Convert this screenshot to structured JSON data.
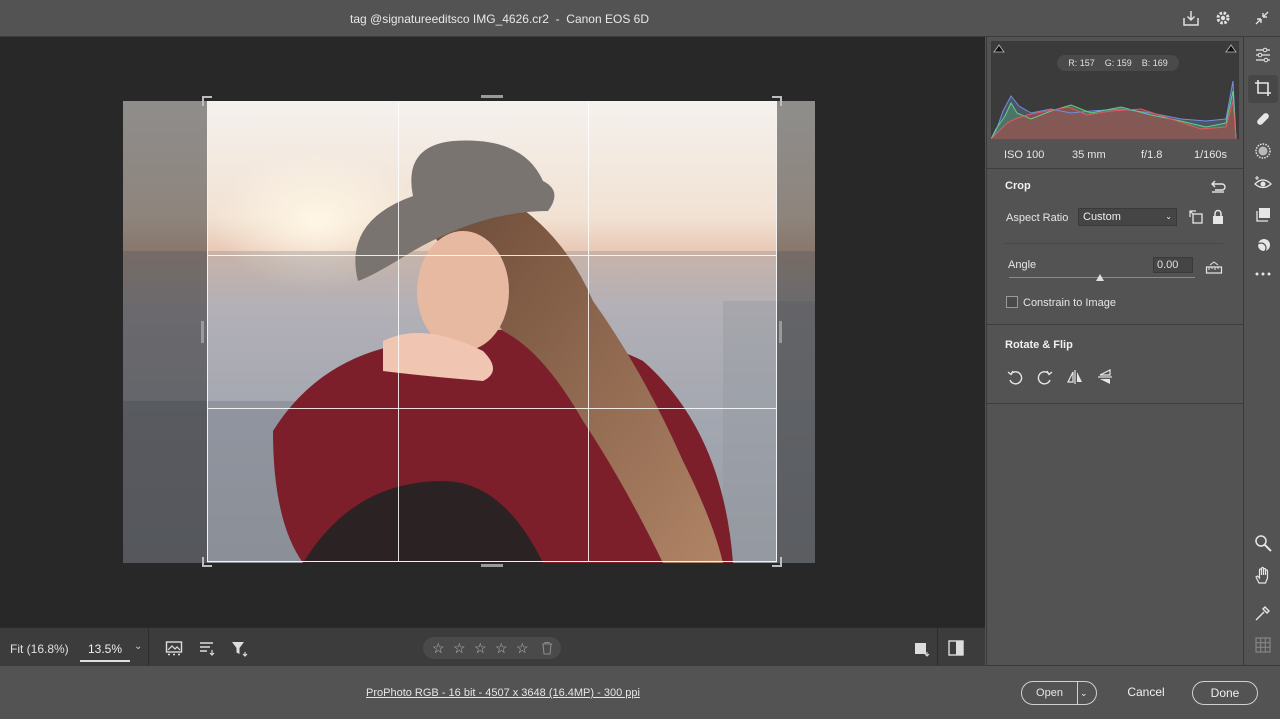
{
  "window": {
    "title": "tag @signatureeditsco IMG_4626.cr2  -  Canon EOS 6D"
  },
  "histogram": {
    "readout": "R: 157    G: 159    B: 169"
  },
  "exif": {
    "iso": "ISO 100",
    "focal": "35 mm",
    "aperture": "f/1.8",
    "shutter": "1/160s"
  },
  "crop_panel": {
    "title": "Crop",
    "aspect_label": "Aspect Ratio",
    "aspect_value": "Custom",
    "angle_label": "Angle",
    "angle_value": "0.00",
    "angle_slider_fraction": 0.5,
    "constrain_label": "Constrain to Image",
    "constrain_checked": false
  },
  "rotate_panel": {
    "title": "Rotate & Flip"
  },
  "bottom_bar": {
    "fit_label": "Fit (16.8%)",
    "zoom_value": "13.5%",
    "rating_stars": [
      "☆",
      "☆",
      "☆",
      "☆",
      "☆"
    ]
  },
  "status": {
    "info": "ProPhoto RGB - 16 bit - 4507 x 3648 (16.4MP) - 300 ppi"
  },
  "buttons": {
    "open": "Open",
    "cancel": "Cancel",
    "done": "Done"
  },
  "icons": {
    "top": [
      "save-icon",
      "settings-icon",
      "collapse-icon"
    ],
    "toolstrip": [
      "edit-sliders-icon",
      "crop-icon",
      "healing-icon",
      "mask-icon",
      "red-eye-icon",
      "snapshots-icon",
      "presets-icon",
      "more-icon",
      "zoom-icon",
      "hand-icon",
      "color-sampler-icon",
      "grid-icon"
    ]
  },
  "colors": {
    "accent": "#e6e6e6",
    "panel": "#535353",
    "canvas": "#282828"
  }
}
